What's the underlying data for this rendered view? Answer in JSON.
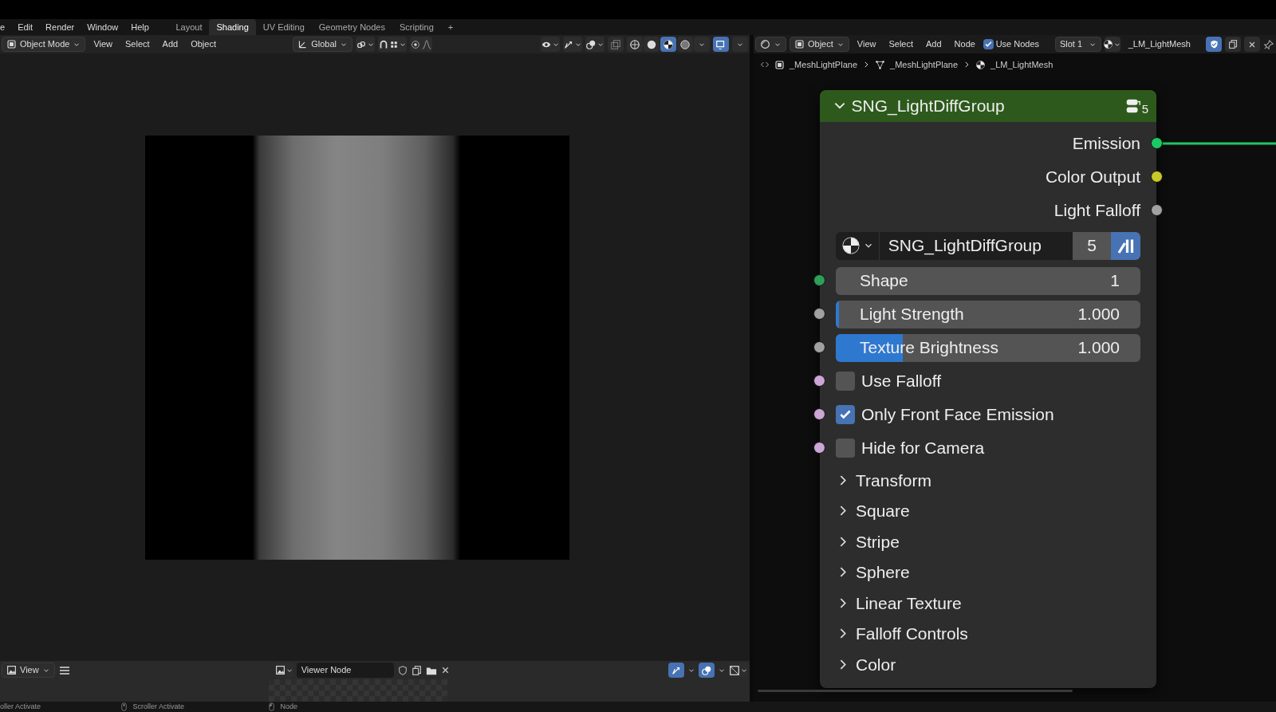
{
  "menu_bar": {
    "menus": [
      "e",
      "Edit",
      "Render",
      "Window",
      "Help"
    ],
    "workspace_tabs": [
      {
        "label": "Layout",
        "selected": false
      },
      {
        "label": "Shading",
        "selected": true
      },
      {
        "label": "UV Editing",
        "selected": false
      },
      {
        "label": "Geometry Nodes",
        "selected": false
      },
      {
        "label": "Scripting",
        "selected": false
      }
    ],
    "add_tab": "+"
  },
  "viewport": {
    "header": {
      "mode": "Object Mode",
      "menus": [
        "View",
        "Select",
        "Add",
        "Object"
      ],
      "orientation": "Global",
      "shading_modes": [
        {
          "selected": false
        },
        {
          "selected": false
        },
        {
          "selected": true
        },
        {
          "selected": false
        }
      ]
    }
  },
  "image_editor": {
    "header": {
      "view_menu": "View",
      "image_name": "Viewer Node"
    }
  },
  "node_editor": {
    "header": {
      "object_type": "Object",
      "menus": [
        "View",
        "Select",
        "Add",
        "Node"
      ],
      "use_nodes": {
        "label": "Use Nodes",
        "checked": true
      },
      "slot": "Slot 1",
      "material": "_LM_LightMesh"
    },
    "breadcrumbs": [
      "_MeshLightPlane",
      "_MeshLightPlane",
      "_LM_LightMesh"
    ],
    "node": {
      "title": "SNG_LightDiffGroup",
      "user_count": "5",
      "outputs": [
        {
          "label": "Emission",
          "color": "#1ec864"
        },
        {
          "label": "Color Output",
          "color": "#c8c828"
        },
        {
          "label": "Light Falloff",
          "color": "#a1a1a1"
        }
      ],
      "datablock": {
        "name": "SNG_LightDiffGroup",
        "users": "5"
      },
      "inputs": [
        {
          "kind": "number",
          "label": "Shape",
          "value": "1",
          "color": "#2e9e58"
        },
        {
          "kind": "slider",
          "label": "Light Strength",
          "value": "1.000",
          "level": 0.01,
          "color": "#a1a1a1"
        },
        {
          "kind": "slider",
          "label": "Texture Brightness",
          "value": "1.000",
          "level": 0.22,
          "color": "#a1a1a1"
        },
        {
          "kind": "checkbox",
          "label": "Use Falloff",
          "checked": false,
          "color": "#cca6d6"
        },
        {
          "kind": "checkbox",
          "label": "Only Front Face Emission",
          "checked": true,
          "color": "#cca6d6"
        },
        {
          "kind": "checkbox",
          "label": "Hide for Camera",
          "checked": false,
          "color": "#cca6d6"
        }
      ],
      "panels": [
        {
          "label": "Transform",
          "expanded": false
        },
        {
          "label": "Square",
          "expanded": false
        },
        {
          "label": "Stripe",
          "expanded": false
        },
        {
          "label": "Sphere",
          "expanded": false
        },
        {
          "label": "Linear Texture",
          "expanded": false
        },
        {
          "label": "Falloff Controls",
          "expanded": false
        },
        {
          "label": "Color",
          "expanded": false
        }
      ]
    }
  },
  "status_bar": [
    "oller Activate",
    "Scroller Activate",
    "Node"
  ]
}
